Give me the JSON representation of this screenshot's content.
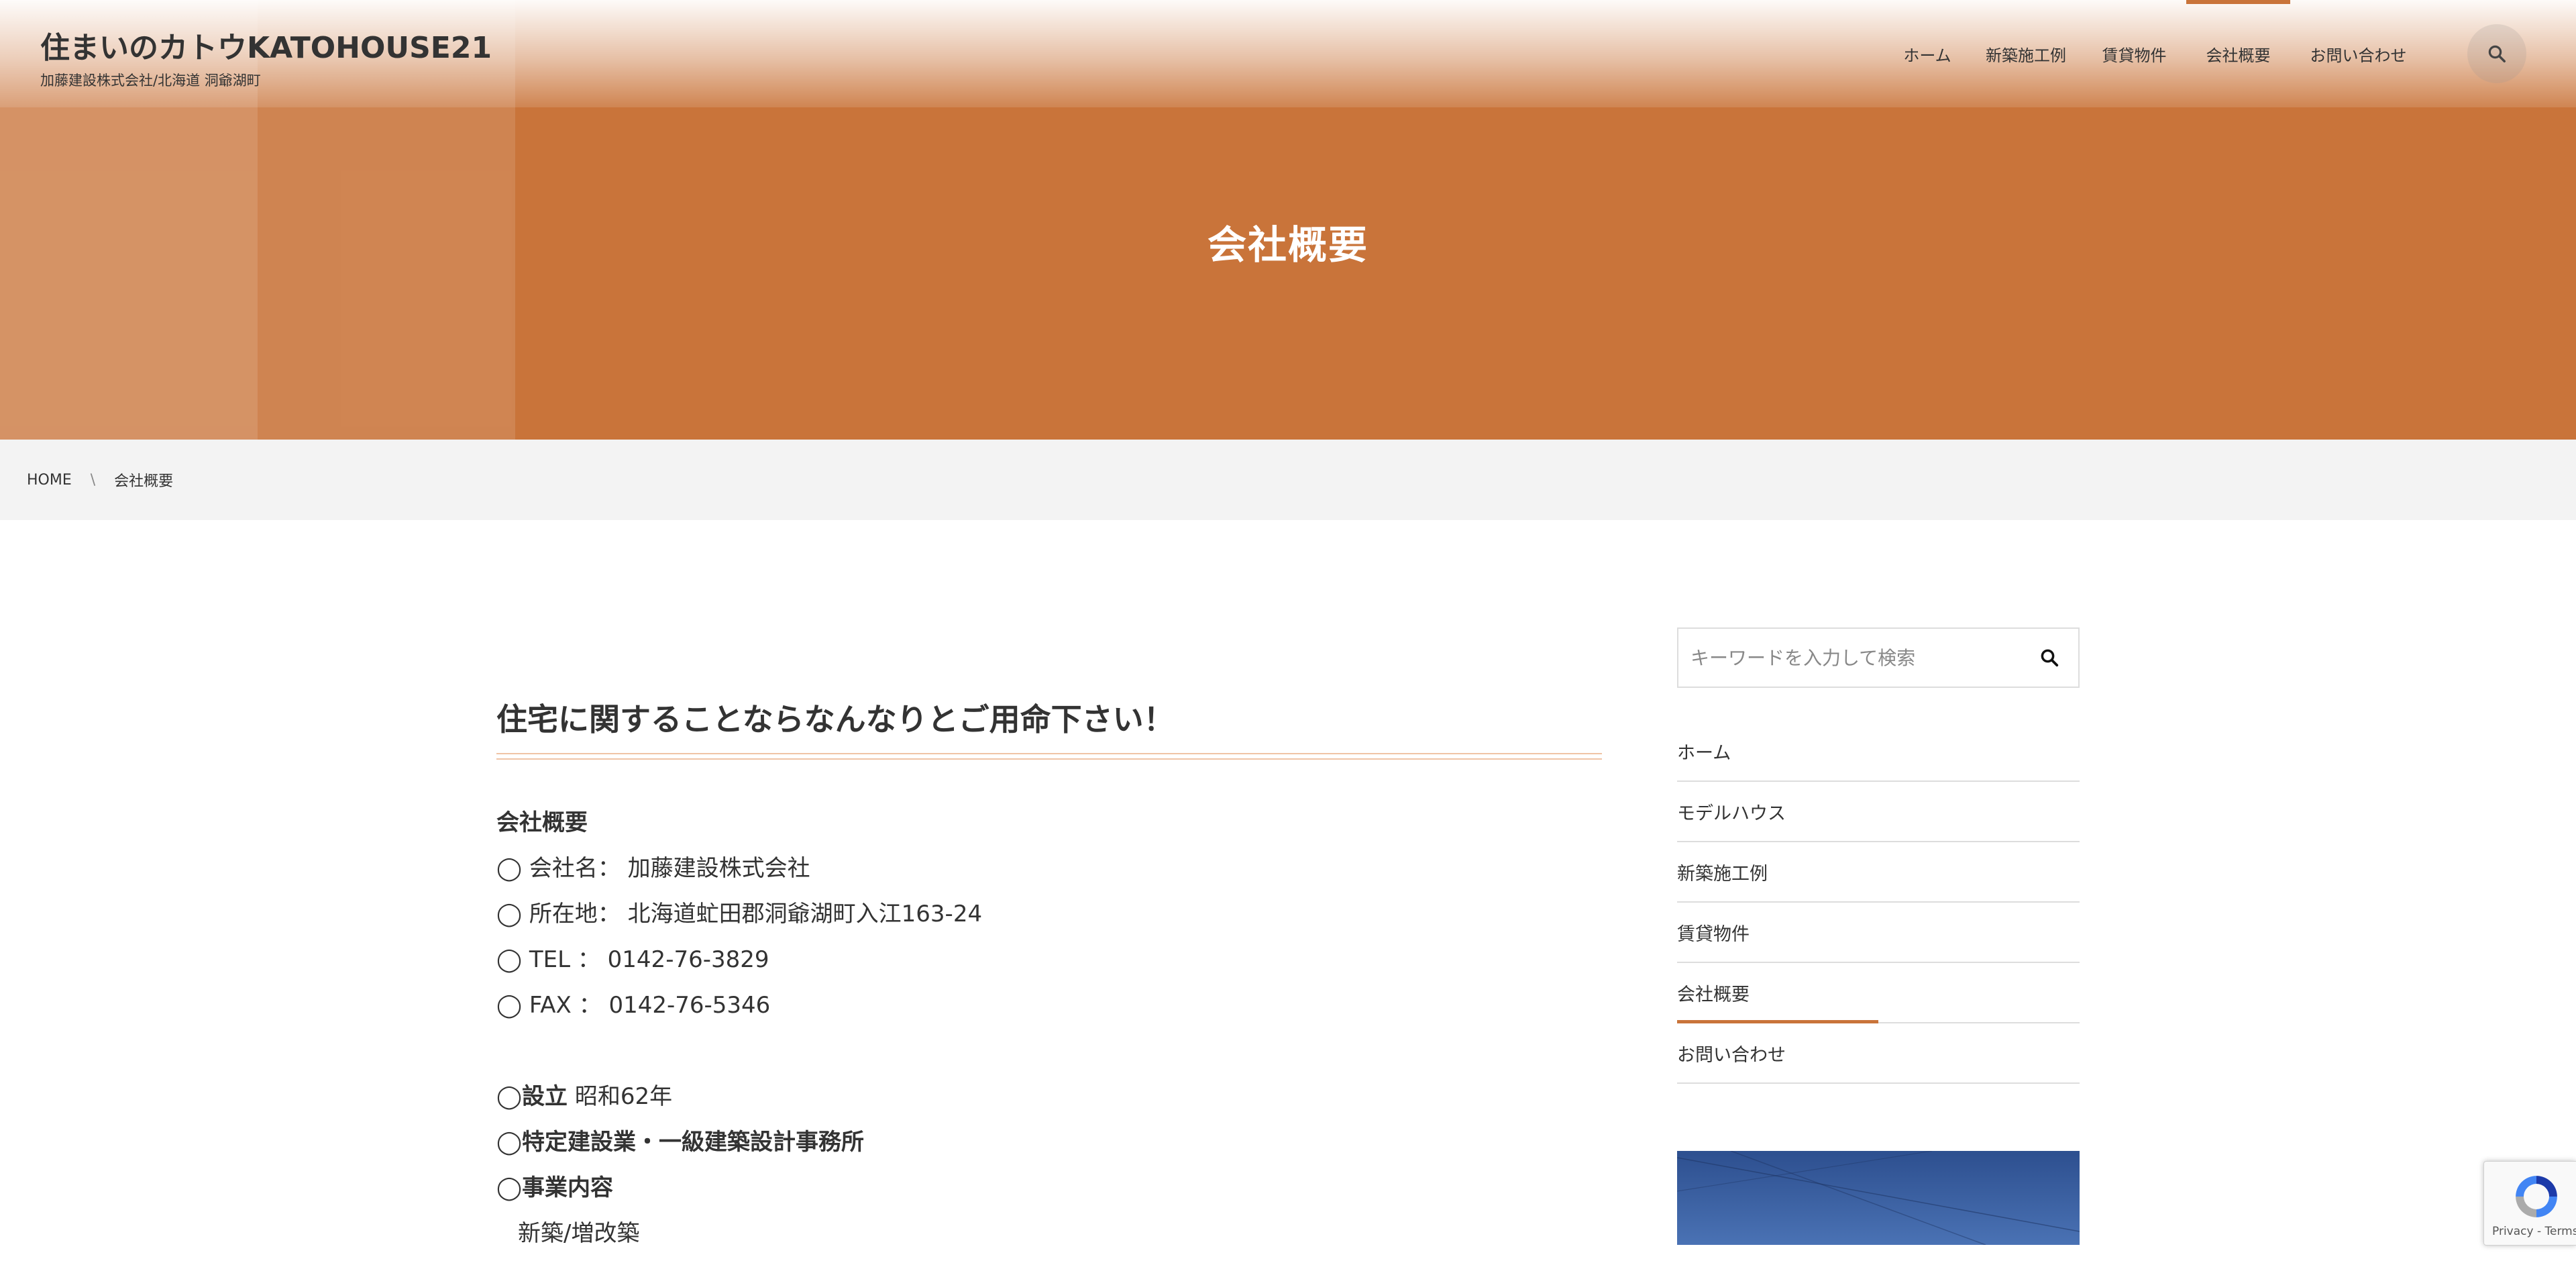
{
  "header": {
    "site_title": "住まいのカトウKATOHOUSE21",
    "tagline": "加藤建設株式会社/北海道 洞爺湖町",
    "nav": [
      {
        "label": "ホーム"
      },
      {
        "label": "新築施工例"
      },
      {
        "label": "賃貸物件"
      },
      {
        "label": "会社概要",
        "active": true
      },
      {
        "label": "お問い合わせ"
      }
    ],
    "search_icon": "search-icon"
  },
  "hero": {
    "title": "会社概要",
    "color": "#c9743a"
  },
  "breadcrumb": {
    "home": "HOME",
    "separator": "\\",
    "current": "会社概要"
  },
  "main": {
    "heading": "住宅に関することならなんなりとご用命下さい！",
    "section_title": "会社概要",
    "company_name": "◯ 会社名： 加藤建設株式会社",
    "address": "◯ 所在地： 北海道虻田郡洞爺湖町入江163-24",
    "tel": "◯ TEL ： 0142-76-3829",
    "fax": "◯ FAX ： 0142-76-5346",
    "established_label": "◯設立",
    "established_value": " 昭和62年",
    "license": "◯特定建設業・一級建築設計事務所",
    "business_label": "◯事業内容",
    "business_item": "新築/増改築"
  },
  "sidebar": {
    "search_placeholder": "キーワードを入力して検索",
    "nav": [
      {
        "label": "ホーム"
      },
      {
        "label": "モデルハウス"
      },
      {
        "label": "新築施工例"
      },
      {
        "label": "賃貸物件"
      },
      {
        "label": "会社概要",
        "active": true
      },
      {
        "label": "お問い合わせ"
      }
    ]
  },
  "recaptcha": {
    "links": "Privacy - Terms"
  },
  "colors": {
    "accent": "#c9743a",
    "text": "#333333",
    "breadcrumb_bg": "#f3f3f3"
  }
}
